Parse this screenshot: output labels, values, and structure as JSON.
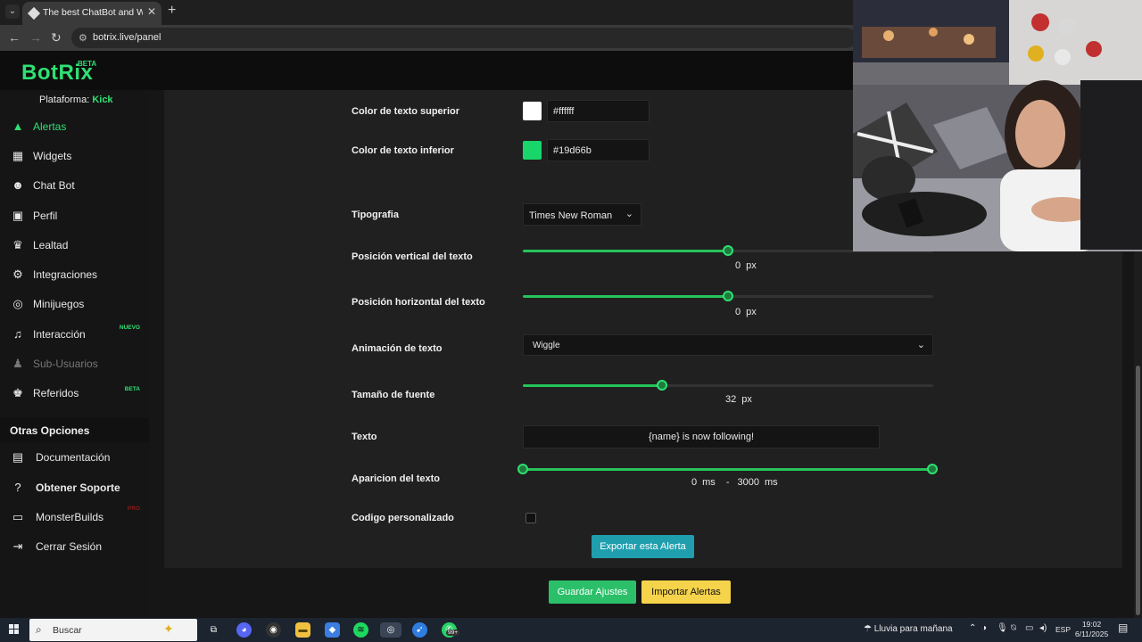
{
  "browser": {
    "tab_title": "The best ChatBot and Widgets",
    "url": "botrix.live/panel"
  },
  "app": {
    "logo": "BotRix",
    "logo_badge": "BETA"
  },
  "sidebar": {
    "platform_label": "Plataforma:",
    "platform_value": "Kick",
    "items": [
      {
        "label": "Alertas",
        "icon": "bell-icon",
        "active": true
      },
      {
        "label": "Widgets",
        "icon": "grid-icon"
      },
      {
        "label": "Chat Bot",
        "icon": "robot-icon"
      },
      {
        "label": "Perfil",
        "icon": "id-card-icon"
      },
      {
        "label": "Lealtad",
        "icon": "trophy-icon"
      },
      {
        "label": "Integraciones",
        "icon": "plug-icon"
      },
      {
        "label": "Minijuegos",
        "icon": "gamepad-icon"
      },
      {
        "label": "Interacción",
        "icon": "music-icon",
        "badge": "NUEVO"
      },
      {
        "label": "Sub-Usuarios",
        "icon": "users-icon",
        "disabled": true
      },
      {
        "label": "Referidos",
        "icon": "user-plus-icon",
        "badge": "BETA"
      }
    ],
    "other_options_title": "Otras Opciones",
    "other_options": [
      {
        "label": "Documentación",
        "icon": "book-icon"
      },
      {
        "label": "Obtener Soporte",
        "icon": "question-icon",
        "bold": true
      },
      {
        "label": "MonsterBuilds",
        "icon": "laptop-icon",
        "badge": "PRO"
      },
      {
        "label": "Cerrar Sesión",
        "icon": "sign-out-icon"
      }
    ]
  },
  "form": {
    "top_text_color": {
      "label": "Color de texto superior",
      "value": "#ffffff",
      "color": "#ffffff"
    },
    "bottom_text_color": {
      "label": "Color de texto inferior",
      "value": "#19d66b",
      "color": "#19d66b"
    },
    "font": {
      "label": "Tipografia",
      "value": "Times New Roman"
    },
    "vertical_pos": {
      "label": "Posición vertical del texto",
      "value": "0",
      "unit": "px",
      "fraction": 0.5
    },
    "horizontal_pos": {
      "label": "Posición horizontal del texto",
      "value": "0",
      "unit": "px",
      "fraction": 0.5
    },
    "animation": {
      "label": "Animación de texto",
      "value": "Wiggle"
    },
    "font_size": {
      "label": "Tamaño de fuente",
      "value": "32",
      "unit": "px",
      "fraction": 0.34
    },
    "text": {
      "label": "Texto",
      "value": "{name} is now following!"
    },
    "appearance": {
      "label": "Aparicion del texto",
      "min": "0",
      "max": "3000",
      "unit": "ms",
      "separator": "-"
    },
    "custom_code": {
      "label": "Codigo personalizado",
      "checked": false
    }
  },
  "buttons": {
    "export": "Exportar esta Alerta",
    "save": "Guardar Ajustes",
    "import": "Importar Alertas"
  },
  "taskbar": {
    "search": "Buscar",
    "weather": "Lluvia para mañana",
    "lang": "ESP",
    "time": "19:02",
    "date": "6/11/2025",
    "whatsapp_badge": "99+"
  },
  "colors": {
    "accent": "#2fe073",
    "export": "#1f9fae",
    "save": "#2cbf6a",
    "import": "#f5d34a"
  }
}
